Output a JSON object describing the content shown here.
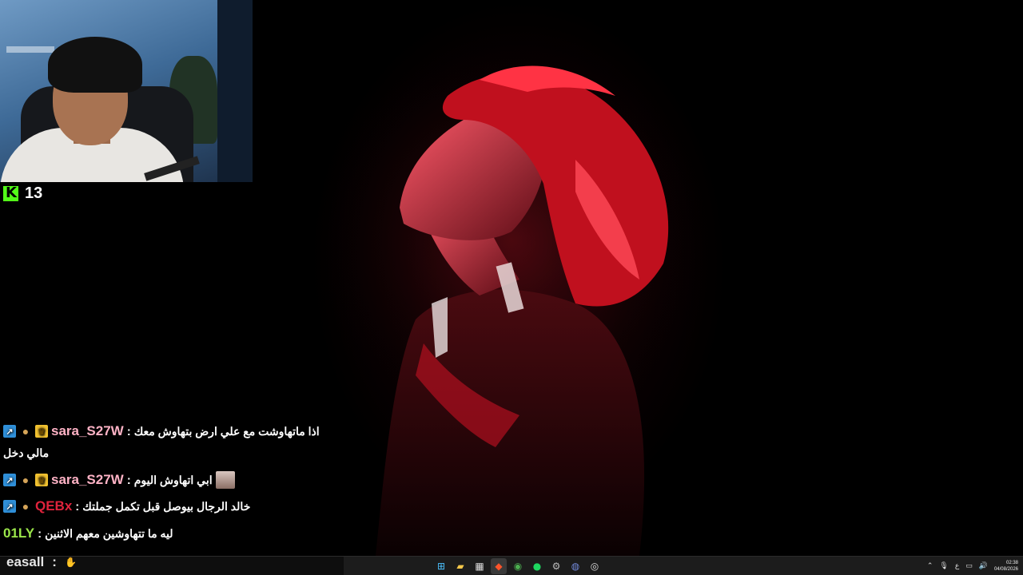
{
  "kick": {
    "follower_count": "13"
  },
  "chat": [
    {
      "user": "sara_S27W",
      "user_color": "#ffb3c6",
      "badges": [
        "arrow-badge-icon",
        "cookie-badge-icon",
        "crown-badge-icon"
      ],
      "separator": ":",
      "message": "اذا ماتهاوشت مع علي ارض بتهاوش معك",
      "continuation": "مالي دخل"
    },
    {
      "user": "sara_S27W",
      "user_color": "#ffb3c6",
      "badges": [
        "arrow-badge-icon",
        "cookie-badge-icon",
        "crown-badge-icon"
      ],
      "separator": ":",
      "message": "ابي اتهاوش اليوم"
    },
    {
      "user": "QEBx",
      "user_color": "#e0233c",
      "badges": [
        "arrow-badge-icon",
        "cookie-badge-icon"
      ],
      "separator": ":",
      "message": "خالد الرجال بيوصل قبل تكمل جملتك"
    },
    {
      "user": "01LY",
      "user_color": "#9be64a",
      "badges": [],
      "separator": ":",
      "message": "ليه ما تتهاوشين معهم الاثنين"
    }
  ],
  "chat_input": {
    "user": "easall",
    "separator": ":"
  },
  "taskbar": {
    "apps": [
      "windows-start-icon",
      "file-explorer-icon",
      "calendar-app-icon",
      "brave-browser-icon",
      "chrome-icon",
      "spotify-icon",
      "settings-icon",
      "discord-icon",
      "obs-icon"
    ],
    "tray": {
      "ime": "ع",
      "time": "02:38",
      "date": "04/08/2026"
    }
  },
  "colors": {
    "wallpaper_red": "#e0202e",
    "kick_green": "#53fc18",
    "taskbar_bg": "#1c1c1c"
  }
}
